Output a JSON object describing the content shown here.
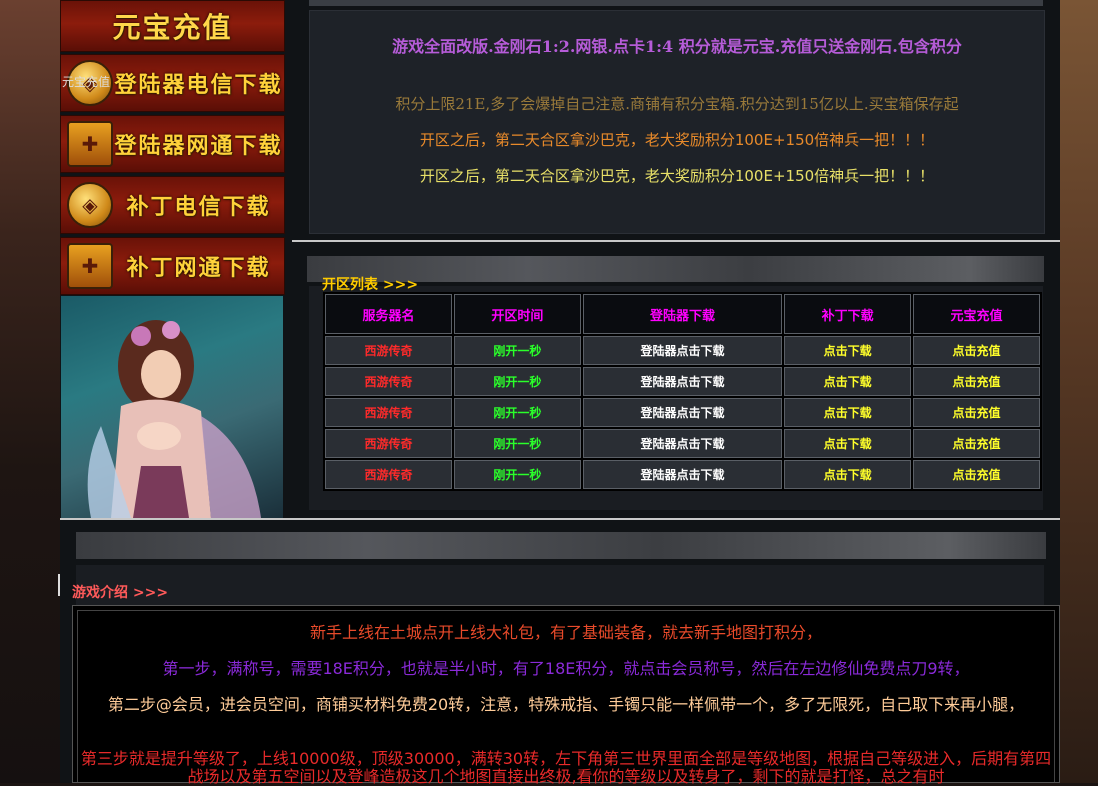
{
  "left_buttons": {
    "recharge": "元宝充值",
    "alt_text": "元宝充值",
    "launcher_telecom": "登陆器电信下载",
    "launcher_netcom": "登陆器网通下载",
    "patch_telecom": "补丁电信下载",
    "patch_netcom": "补丁网通下载"
  },
  "notice": {
    "line1": "游戏全面改版.金刚石1:2.网银.点卡1:4 积分就是元宝.充值只送金刚石.包含积分",
    "line2": "积分上限21E,多了会爆掉自己注意.商铺有积分宝箱.积分达到15亿以上.买宝箱保存起",
    "line3": "开区之后，第二天合区拿沙巴克，老大奖励积分100E+150倍神兵一把！！！",
    "line4": "开区之后，第二天合区拿沙巴克，老大奖励积分100E+150倍神兵一把！！！"
  },
  "server_list": {
    "title": "开区列表 >>>",
    "headers": [
      "服务器名",
      "开区时间",
      "登陆器下载",
      "补丁下载",
      "元宝充值"
    ],
    "rows": [
      [
        "西游传奇",
        "刚开一秒",
        "登陆器点击下载",
        "点击下载",
        "点击充值"
      ],
      [
        "西游传奇",
        "刚开一秒",
        "登陆器点击下载",
        "点击下载",
        "点击充值"
      ],
      [
        "西游传奇",
        "刚开一秒",
        "登陆器点击下载",
        "点击下载",
        "点击充值"
      ],
      [
        "西游传奇",
        "刚开一秒",
        "登陆器点击下载",
        "点击下载",
        "点击充值"
      ],
      [
        "西游传奇",
        "刚开一秒",
        "登陆器点击下载",
        "点击下载",
        "点击充值"
      ]
    ]
  },
  "intro": {
    "title": "游戏介绍 >>>",
    "p1": "新手上线在土城点开上线大礼包，有了基础装备，就去新手地图打积分，",
    "p2": "第一步，满称号，需要18E积分，也就是半小时，有了18E积分，就点击会员称号，然后在左边修仙免费点刀9转，",
    "p3": "第二步@会员，进会员空间，商铺买材料免费20转，注意，特殊戒指、手镯只能一样佩带一个，多了无限死，自己取下来再小腿，",
    "p4": "第三步就是提升等级了，上线10000级，顶级30000，满转30转，左下角第三世界里面全部是等级地图，根据自己等级进入，后期有第四战场以及第五空间以及登峰造极这几个地图直接出终极,看你的等级以及转身了，剩下的就是打怪，总之有时"
  }
}
